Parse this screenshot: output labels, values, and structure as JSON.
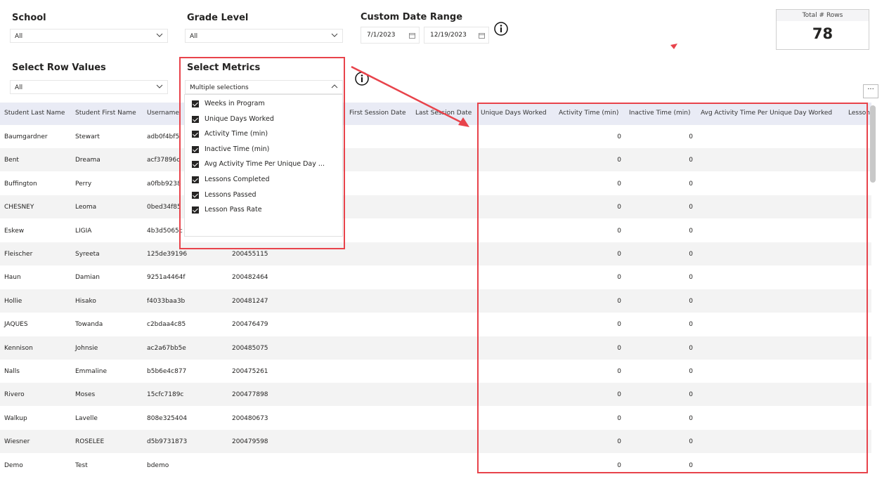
{
  "filters": {
    "school": {
      "title": "School",
      "value": "All"
    },
    "grade": {
      "title": "Grade Level",
      "value": "All"
    },
    "date_range": {
      "title": "Custom Date Range",
      "start": "7/1/2023",
      "end": "12/19/2023"
    },
    "row_values": {
      "title": "Select Row Values",
      "value": "All"
    },
    "metrics": {
      "title": "Select Metrics",
      "value": "Multiple selections",
      "options": [
        {
          "label": "Weeks in Program",
          "checked": true
        },
        {
          "label": "Unique Days Worked",
          "checked": true
        },
        {
          "label": "Activity Time (min)",
          "checked": true
        },
        {
          "label": "Inactive Time (min)",
          "checked": true
        },
        {
          "label": "Avg Activity Time Per Unique Day ...",
          "checked": true
        },
        {
          "label": "Lessons Completed",
          "checked": true
        },
        {
          "label": "Lessons Passed",
          "checked": true
        },
        {
          "label": "Lesson Pass Rate",
          "checked": true
        }
      ]
    }
  },
  "kpi": {
    "label": "Total # Rows",
    "value": "78"
  },
  "more_button": "···",
  "table": {
    "columns": [
      "Student Last Name",
      "Student First Name",
      "Username",
      "First Session Date",
      "Last Session Date",
      "Unique Days Worked",
      "Activity Time (min)",
      "Inactive Time (min)",
      "Avg Activity Time Per Unique Day Worked",
      "Lesson"
    ],
    "rows": [
      {
        "last": "Baumgardner",
        "first": "Stewart",
        "user": "adb0f4bf5",
        "id": "",
        "activity": "0",
        "inactive": "0"
      },
      {
        "last": "Bent",
        "first": "Dreama",
        "user": "acf37896c",
        "id": "",
        "activity": "0",
        "inactive": "0"
      },
      {
        "last": "Buffington",
        "first": "Perry",
        "user": "a0fbb9238",
        "id": "",
        "activity": "0",
        "inactive": "0"
      },
      {
        "last": "CHESNEY",
        "first": "Leoma",
        "user": "0bed34f85",
        "id": "",
        "activity": "0",
        "inactive": "0"
      },
      {
        "last": "Eskew",
        "first": "LIGIA",
        "user": "4b3d5065c",
        "id": "",
        "activity": "0",
        "inactive": "0"
      },
      {
        "last": "Fleischer",
        "first": "Syreeta",
        "user": "125de39196",
        "id": "200455115",
        "activity": "0",
        "inactive": "0"
      },
      {
        "last": "Haun",
        "first": "Damian",
        "user": "9251a4464f",
        "id": "200482464",
        "activity": "0",
        "inactive": "0"
      },
      {
        "last": "Hollie",
        "first": "Hisako",
        "user": "f4033baa3b",
        "id": "200481247",
        "activity": "0",
        "inactive": "0"
      },
      {
        "last": "JAQUES",
        "first": "Towanda",
        "user": "c2bdaa4c85",
        "id": "200476479",
        "activity": "0",
        "inactive": "0"
      },
      {
        "last": "Kennison",
        "first": "Johnsie",
        "user": "ac2a67bb5e",
        "id": "200485075",
        "activity": "0",
        "inactive": "0"
      },
      {
        "last": "Nalls",
        "first": "Emmaline",
        "user": "b5b6e4c877",
        "id": "200475261",
        "activity": "0",
        "inactive": "0"
      },
      {
        "last": "Rivero",
        "first": "Moses",
        "user": "15cfc7189c",
        "id": "200477898",
        "activity": "0",
        "inactive": "0"
      },
      {
        "last": "Walkup",
        "first": "Lavelle",
        "user": "808e325404",
        "id": "200480673",
        "activity": "0",
        "inactive": "0"
      },
      {
        "last": "Wiesner",
        "first": "ROSELEE",
        "user": "d5b9731873",
        "id": "200479598",
        "activity": "0",
        "inactive": "0"
      },
      {
        "last": "Demo",
        "first": "Test",
        "user": "bdemo",
        "id": "",
        "activity": "0",
        "inactive": "0"
      }
    ]
  },
  "colors": {
    "annotation": "#e8434b",
    "header_bg": "#e9ebf5",
    "alt_row": "#f3f3f3"
  }
}
